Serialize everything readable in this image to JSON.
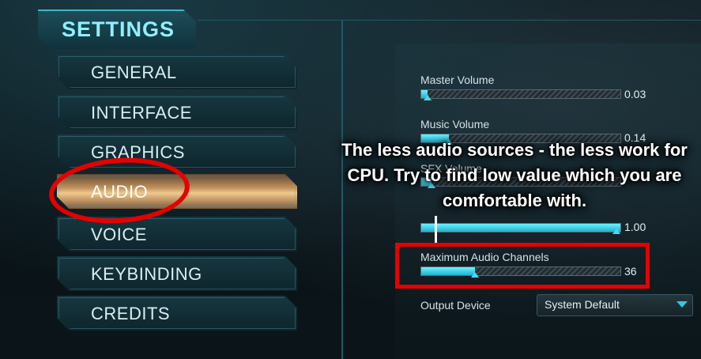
{
  "sidebar": {
    "title": "SETTINGS",
    "items": [
      {
        "label": "GENERAL"
      },
      {
        "label": "INTERFACE"
      },
      {
        "label": "GRAPHICS"
      },
      {
        "label": "AUDIO",
        "active": true
      },
      {
        "label": "VOICE"
      },
      {
        "label": "KEYBINDING"
      },
      {
        "label": "CREDITS"
      }
    ]
  },
  "audio": {
    "sliders": [
      {
        "label": "Master Volume",
        "value": "0.03",
        "fraction": 0.03
      },
      {
        "label": "Music Volume",
        "value": "0.14",
        "fraction": 0.14
      },
      {
        "label": "SFX Volume",
        "value": "",
        "fraction": 0.05
      },
      {
        "label": "",
        "value": "1.00",
        "fraction": 1.0
      },
      {
        "label": "Maximum Audio Channels",
        "value": "36",
        "fraction": 0.27
      }
    ],
    "output_device": {
      "label": "Output Device",
      "value": "System Default"
    }
  },
  "annotation": {
    "text": "The less audio sources - the less work for CPU. Try to find low value which you are comfortable with.",
    "color": "#e60000"
  },
  "colors": {
    "accent": "#2fc7e2",
    "active_tab": "#f2c88d",
    "highlight": "#e60000"
  }
}
